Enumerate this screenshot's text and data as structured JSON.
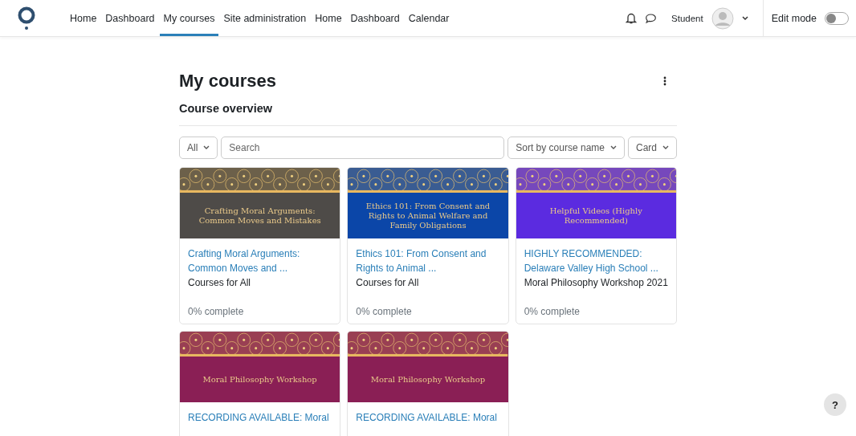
{
  "nav": {
    "items": [
      {
        "label": "Home",
        "selected": false
      },
      {
        "label": "Dashboard",
        "selected": false
      },
      {
        "label": "My courses",
        "selected": true
      },
      {
        "label": "Site administration",
        "selected": false
      },
      {
        "label": "Home",
        "selected": false
      },
      {
        "label": "Dashboard",
        "selected": false
      },
      {
        "label": "Calendar",
        "selected": false
      }
    ],
    "user_name": "Student",
    "edit_mode": {
      "label": "Edit mode",
      "on": false
    }
  },
  "page": {
    "title": "My courses",
    "section_title": "Course overview"
  },
  "filters": {
    "grouping": "All",
    "search": {
      "placeholder": "Search"
    },
    "sort": "Sort by course name",
    "view": "Card"
  },
  "courses": [
    {
      "banner_title": "Crafting Moral Arguments: Common Moves and Mistakes",
      "color": "#4e4b48",
      "title_lines": [
        "Crafting Moral Arguments:",
        "Common Moves and ..."
      ],
      "category": "Courses for All",
      "progress": "0% complete"
    },
    {
      "banner_title": "Ethics 101: From Consent and Rights to Animal Welfare and Family Obligations",
      "color": "#0b46a8",
      "title_lines": [
        "Ethics 101: From Consent and",
        "Rights to Animal ..."
      ],
      "category": "Courses for All",
      "progress": "0% complete"
    },
    {
      "banner_title": "Helpful Videos (Highly Recommended)",
      "color": "#5b2be0",
      "title_lines": [
        "HIGHLY RECOMMENDED:",
        "Delaware Valley High School ..."
      ],
      "category": "Moral Philosophy Workshop 2021",
      "progress": "0% complete"
    },
    {
      "banner_title": "Moral Philosophy Workshop",
      "color": "#8a1f55",
      "title_lines": [
        "RECORDING AVAILABLE: Moral"
      ]
    },
    {
      "banner_title": "Moral Philosophy Workshop",
      "color": "#8a1f55",
      "title_lines": [
        "RECORDING AVAILABLE: Moral"
      ]
    }
  ],
  "help_button": "?"
}
